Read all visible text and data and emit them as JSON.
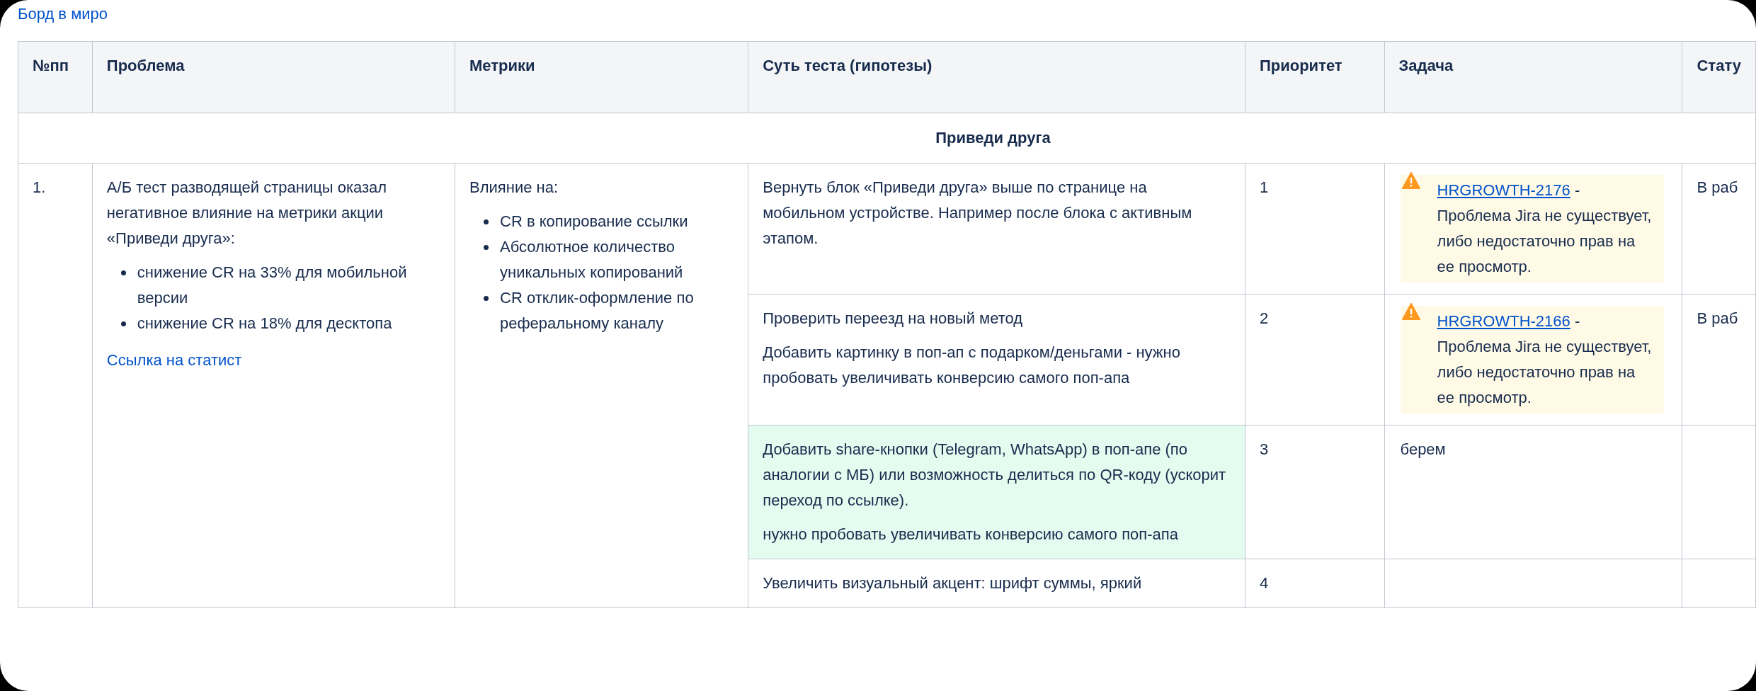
{
  "top_link": "Борд в миро",
  "table": {
    "columns": [
      "№пп",
      "Проблема",
      "Метрики",
      "Суть теста (гипотезы)",
      "Приоритет",
      "Задача",
      "Стату"
    ],
    "group": "Приведи друга",
    "row": {
      "number": "1.",
      "problem": {
        "text": "А/Б тест разводящей страницы оказал негативное влияние на метрики акции «Приведи друга»:",
        "bullets": [
          "снижение CR на 33% для мобильной версии",
          "снижение CR на 18% для десктопа"
        ],
        "link": "Ссылка на статист"
      },
      "metrics": {
        "title": "Влияние на:",
        "bullets": [
          "CR в копирование ссылки",
          "Абсолютное количество уникальных копирований",
          "CR отклик-оформление по реферальному каналу"
        ]
      },
      "hypotheses": [
        {
          "paragraphs": [
            "Вернуть блок «Приведи друга» выше по странице на мобильном устройстве. Например после блока с активным этапом."
          ],
          "priority": "1",
          "task": {
            "kind": "jira",
            "key": "HRGROWTH-2176",
            "message": "- Проблема Jira не существует, либо недостаточно прав на ее просмотр."
          },
          "status": "В раб",
          "highlighted": false
        },
        {
          "paragraphs": [
            "Проверить переезд на новый метод",
            "Добавить картинку в поп-ап с подарком/деньгами - нужно пробовать увеличивать конверсию самого поп-апа"
          ],
          "priority": "2",
          "task": {
            "kind": "jira",
            "key": "HRGROWTH-2166",
            "message": "- Проблема Jira не существует, либо недостаточно прав на ее просмотр."
          },
          "status": "В раб",
          "highlighted": false
        },
        {
          "paragraphs": [
            "Добавить share-кнопки (Telegram, WhatsApp) в поп-апе (по аналогии с МБ) или возможность делиться по QR-коду (ускорит переход по ссылке).",
            "нужно пробовать увеличивать конверсию самого поп-апа"
          ],
          "priority": "3",
          "task": {
            "kind": "text",
            "text": "берем"
          },
          "highlighted": true
        },
        {
          "paragraphs": [
            "Увеличить визуальный акцент: шрифт суммы, яркий"
          ],
          "priority": "4",
          "highlighted": false
        }
      ]
    }
  }
}
